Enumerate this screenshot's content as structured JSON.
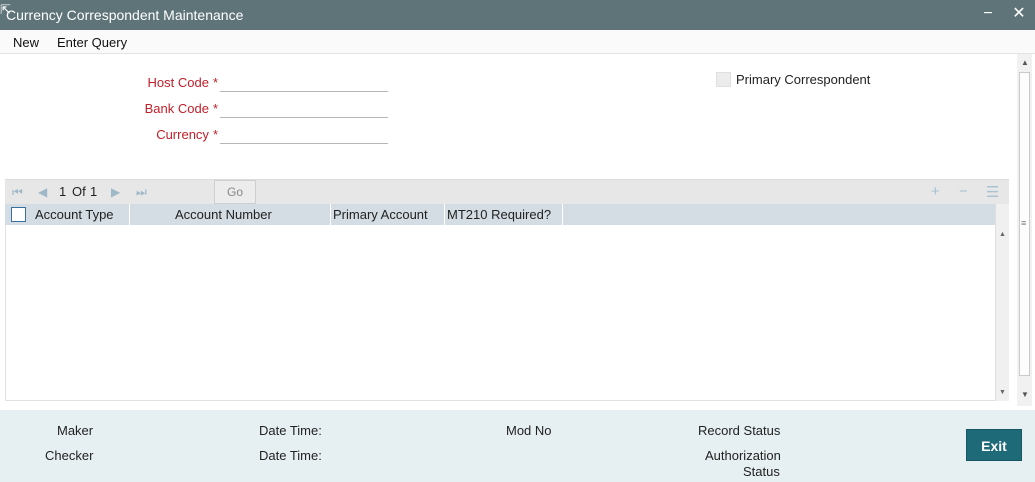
{
  "window": {
    "title": "Currency Correspondent Maintenance",
    "minimize_glyph": "−",
    "close_glyph": "✕"
  },
  "menu": {
    "items": [
      {
        "label": "New"
      },
      {
        "label": "Enter Query"
      }
    ]
  },
  "form": {
    "host_code": {
      "label": "Host Code",
      "required": "*",
      "value": ""
    },
    "bank_code": {
      "label": "Bank Code",
      "required": "*",
      "value": ""
    },
    "currency": {
      "label": "Currency",
      "required": "*",
      "value": ""
    },
    "primary_correspondent": {
      "label": "Primary Correspondent",
      "checked": false
    }
  },
  "grid": {
    "pagination": {
      "current": "1",
      "of_label": "Of",
      "total": "1"
    },
    "go_label": "Go",
    "columns": [
      {
        "label": "Account Type"
      },
      {
        "label": "Account Number"
      },
      {
        "label": "Primary Account"
      },
      {
        "label": "MT210 Required?"
      }
    ],
    "rows": []
  },
  "footer": {
    "maker_label": "Maker",
    "checker_label": "Checker",
    "date_time_label_1": "Date Time:",
    "date_time_label_2": "Date Time:",
    "mod_no_label": "Mod No",
    "record_status_label": "Record Status",
    "authorization_status_label_1": "Authorization",
    "authorization_status_label_2": "Status",
    "exit_label": "Exit"
  },
  "colors": {
    "titlebar": "#5e7479",
    "required_label": "#c0202a",
    "grid_header": "#d3dde3",
    "footer_bg": "#e6f0f2",
    "exit_button": "#1f6a79"
  }
}
